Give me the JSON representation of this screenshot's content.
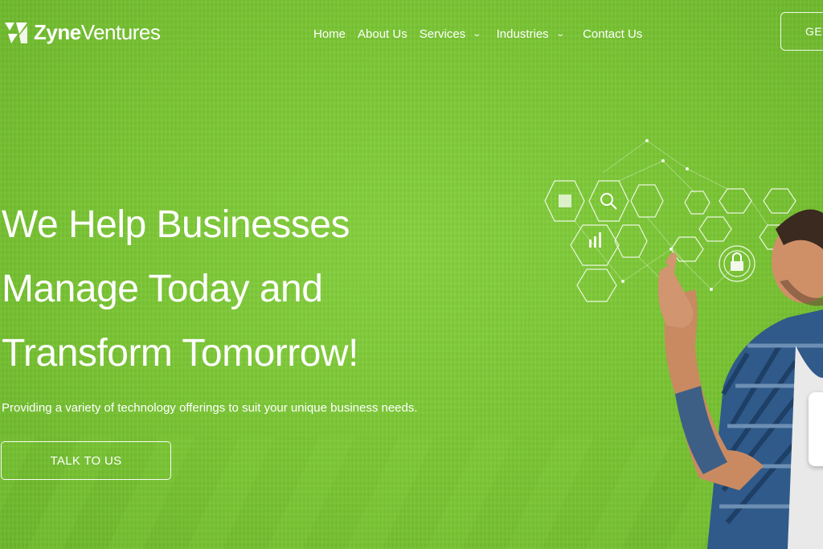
{
  "brand": {
    "name_bold": "Zyne",
    "name_light": "Ventures",
    "logo_icon": "zyne-logo-icon"
  },
  "nav": {
    "items": [
      {
        "label": "Home",
        "has_dropdown": false
      },
      {
        "label": "About Us",
        "has_dropdown": false
      },
      {
        "label": "Services",
        "has_dropdown": true
      },
      {
        "label": "Industries",
        "has_dropdown": true
      },
      {
        "label": "Contact Us",
        "has_dropdown": false
      }
    ],
    "cta_label": "GET"
  },
  "hero": {
    "title_lines": [
      "We Help Businesses",
      "Manage Today and",
      "Transform Tomorrow!"
    ],
    "subtitle": "Providing a variety of technology offerings to suit your unique business needs.",
    "cta_label": "TALK TO US"
  },
  "colors": {
    "background": "#79c433",
    "text": "#ffffff"
  }
}
